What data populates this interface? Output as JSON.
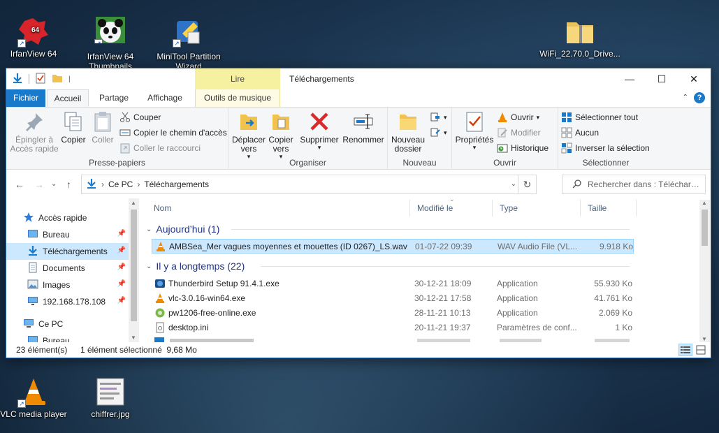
{
  "desktop": {
    "icons_top": [
      {
        "label": "IrfanView 64",
        "badge": "64"
      },
      {
        "label": "IrfanView 64 Thumbnails"
      },
      {
        "label": "MiniTool Partition Wizard"
      },
      {
        "label": "WiFi_22.70.0_Drive..."
      }
    ],
    "icons_bottom": [
      {
        "label": "VLC media player"
      },
      {
        "label": "chiffrer.jpg"
      }
    ]
  },
  "window": {
    "title": "Téléchargements",
    "context_tab_header": "Lire",
    "controls": {
      "minimize": "—",
      "maximize": "☐",
      "close": "✕"
    }
  },
  "tabs": [
    {
      "label": "Fichier"
    },
    {
      "label": "Accueil"
    },
    {
      "label": "Partage"
    },
    {
      "label": "Affichage"
    },
    {
      "label": "Outils de musique"
    }
  ],
  "ribbon": {
    "clipboard": {
      "label": "Presse-papiers",
      "pin_label": "Épingler à Accès rapide",
      "copy_label": "Copier",
      "paste_label": "Coller",
      "cut_label": "Couper",
      "copy_path_label": "Copier le chemin d'accès",
      "paste_shortcut_label": "Coller le raccourci"
    },
    "organize": {
      "label": "Organiser",
      "move_label": "Déplacer vers",
      "copyto_label": "Copier vers",
      "delete_label": "Supprimer",
      "rename_label": "Renommer"
    },
    "new": {
      "label": "Nouveau",
      "new_folder_label": "Nouveau dossier"
    },
    "open": {
      "label": "Ouvrir",
      "properties_label": "Propriétés",
      "open_label": "Ouvrir",
      "edit_label": "Modifier",
      "history_label": "Historique"
    },
    "select": {
      "label": "Sélectionner",
      "select_all_label": "Sélectionner tout",
      "select_none_label": "Aucun",
      "invert_label": "Inverser la sélection"
    }
  },
  "address": {
    "crumbs": [
      "Ce PC",
      "Téléchargements"
    ],
    "search_placeholder": "Rechercher dans : Téléchargements"
  },
  "nav": {
    "items": [
      {
        "label": "Accès rapide"
      },
      {
        "label": "Bureau"
      },
      {
        "label": "Téléchargements"
      },
      {
        "label": "Documents"
      },
      {
        "label": "Images"
      },
      {
        "label": "192.168.178.108"
      },
      {
        "label": "Ce PC"
      },
      {
        "label": "Bureau"
      }
    ]
  },
  "columns": {
    "name": "Nom",
    "date": "Modifié le",
    "type": "Type",
    "size": "Taille"
  },
  "groups": [
    {
      "title": "Aujourd’hui (1)",
      "rows": [
        {
          "name": "AMBSea_Mer vagues moyennes et mouettes (ID 0267)_LS.wav",
          "date": "01-07-22 09:39",
          "type": "WAV Audio File (VL...",
          "size": "9.918 Ko"
        }
      ]
    },
    {
      "title": "Il y a longtemps (22)",
      "rows": [
        {
          "name": "Thunderbird Setup 91.4.1.exe",
          "date": "30-12-21 18:09",
          "type": "Application",
          "size": "55.930 Ko"
        },
        {
          "name": "vlc-3.0.16-win64.exe",
          "date": "30-12-21 17:58",
          "type": "Application",
          "size": "41.761 Ko"
        },
        {
          "name": "pw1206-free-online.exe",
          "date": "28-11-21 10:13",
          "type": "Application",
          "size": "2.069 Ko"
        },
        {
          "name": "desktop.ini",
          "date": "20-11-21 19:37",
          "type": "Paramètres de conf...",
          "size": "1 Ko"
        }
      ]
    }
  ],
  "status": {
    "count": "23 élément(s)",
    "selected": "1 élément sélectionné  9,68 Mo"
  }
}
